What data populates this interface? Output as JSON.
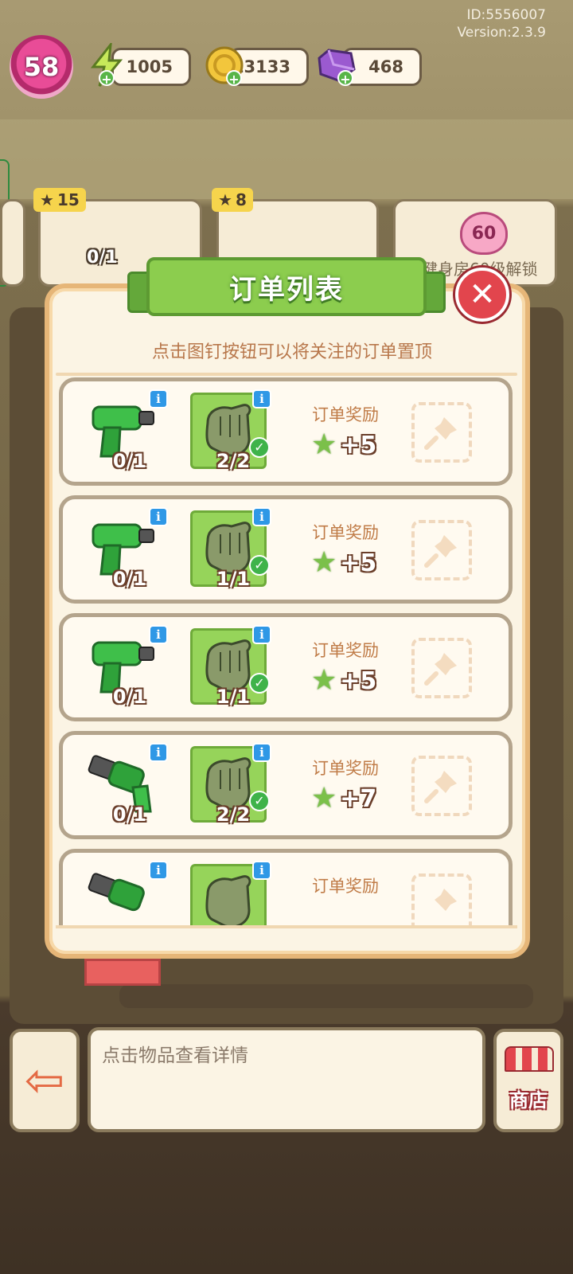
{
  "status": {
    "id_text": "ID:5556007",
    "version_text": "Version:2.3.9"
  },
  "hud": {
    "level": "58",
    "energy": "1005",
    "coins": "13133",
    "gems": "468"
  },
  "background_orders": {
    "card1_stars": "15",
    "card1_progress": "0/1",
    "card2_stars": "8",
    "locked_level": "60",
    "locked_text": "健身房60级解锁"
  },
  "modal": {
    "title": "订单列表",
    "hint": "点击图钉按钮可以将关注的订单置顶",
    "orders": [
      {
        "item1_count": "0/1",
        "item2_count": "2/2",
        "reward_label": "订单奖励",
        "reward_amount": "+5"
      },
      {
        "item1_count": "0/1",
        "item2_count": "1/1",
        "reward_label": "订单奖励",
        "reward_amount": "+5"
      },
      {
        "item1_count": "0/1",
        "item2_count": "1/1",
        "reward_label": "订单奖励",
        "reward_amount": "+5"
      },
      {
        "item1_count": "0/1",
        "item2_count": "2/2",
        "reward_label": "订单奖励",
        "reward_amount": "+7"
      },
      {
        "item1_count": "",
        "item2_count": "",
        "reward_label": "订单奖励",
        "reward_amount": ""
      }
    ]
  },
  "bottom": {
    "detail_placeholder": "点击物品查看详情",
    "shop_label": "商店"
  },
  "colors": {
    "accent_green": "#8ccd4e",
    "close_red": "#e2454d",
    "info_blue": "#2f98e6",
    "hint_brown": "#b8774b"
  }
}
